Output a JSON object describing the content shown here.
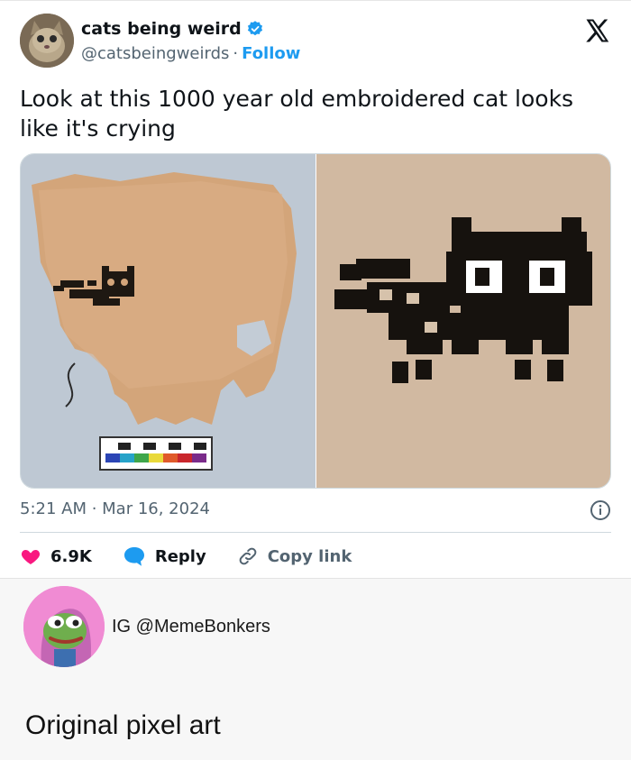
{
  "tweet": {
    "display_name": "cats being weird",
    "handle": "@catsbeingweirds",
    "separator": "·",
    "follow_label": "Follow",
    "text": "Look at this 1000 year old embroidered cat looks like it's crying",
    "timestamp": "5:21 AM · Mar 16, 2024",
    "actions": {
      "likes": "6.9K",
      "reply_label": "Reply",
      "copy_link_label": "Copy link"
    },
    "colors": {
      "accent": "#1d9bf0",
      "like": "#f91880",
      "muted": "#536471"
    }
  },
  "repost": {
    "ig_handle": "IG @MemeBonkers",
    "caption": "Original pixel art"
  },
  "icons": [
    "verified-badge-icon",
    "x-logo-icon",
    "info-icon",
    "heart-icon",
    "reply-bubble-icon",
    "link-icon"
  ]
}
